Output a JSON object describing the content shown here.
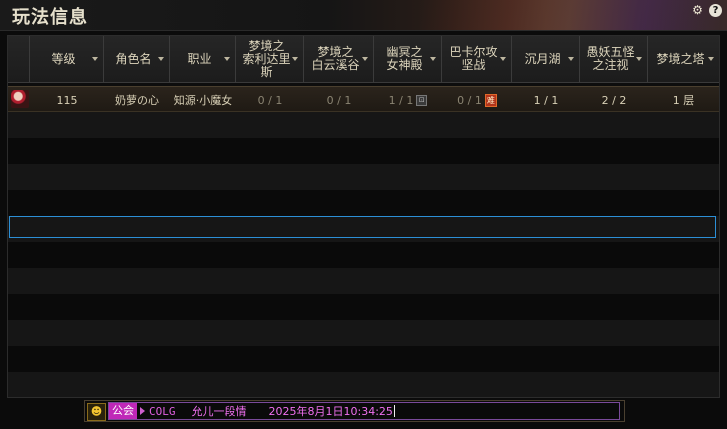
{
  "window": {
    "title": "玩法信息"
  },
  "toolbar": {
    "settings_icon": "gear-icon",
    "help_icon": "help-icon",
    "help_glyph": "?"
  },
  "table": {
    "columns": [
      {
        "label": "等级",
        "sortable": true
      },
      {
        "label": "角色名",
        "sortable": true
      },
      {
        "label": "职业",
        "sortable": true
      },
      {
        "label": "梦境之\n索利达里\n斯",
        "sortable": true
      },
      {
        "label": "梦境之\n白云溪谷",
        "sortable": true
      },
      {
        "label": "幽冥之\n女神殿",
        "sortable": true
      },
      {
        "label": "巴卡尔攻\n坚战",
        "sortable": true
      },
      {
        "label": "沉月湖",
        "sortable": true
      },
      {
        "label": "愚妖五怪\n之注视",
        "sortable": true
      },
      {
        "label": "梦境之塔",
        "sortable": true
      }
    ],
    "rows": [
      {
        "level": "115",
        "name": "奶萝の心",
        "class": "知源·小魔女",
        "solidaris": "0 / 1",
        "baiyun": "0 / 1",
        "goddess": "1 / 1",
        "goddess_badge": "lock-icon",
        "bakal": "0 / 1",
        "bakal_badge": "难",
        "moonlake": "1 / 1",
        "fivemonsters": "2 / 2",
        "tower": "1 层"
      }
    ]
  },
  "chat": {
    "emoji_icon": "emoji-icon",
    "guild_tag": "公会",
    "sender": "COLG",
    "message": "允儿一段情",
    "timestamp": "2025年8月1日10:34:25"
  },
  "colors": {
    "selection": "#2c8fd6",
    "guild": "#c028b8",
    "title": "#e6e0cc"
  }
}
